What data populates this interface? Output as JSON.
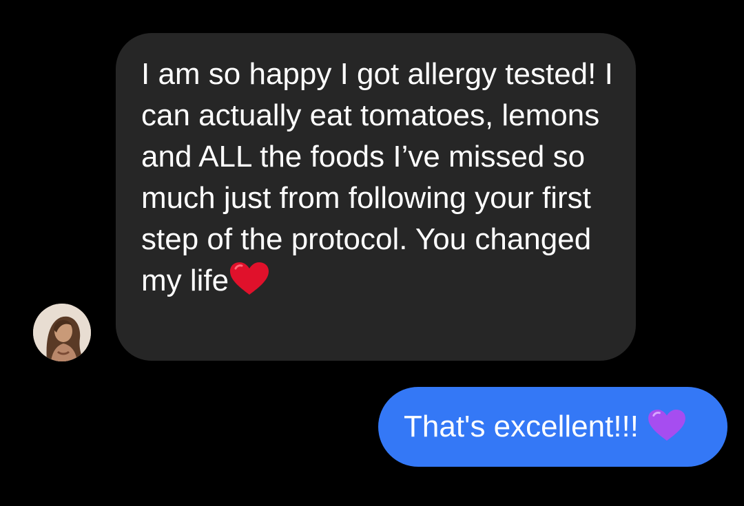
{
  "conversation": {
    "incoming": {
      "sender_avatar": "profile-photo",
      "text": "I am so happy I got allergy tested! I can actually eat tomatoes, lemons and ALL the foods I’ve missed so much just from following your first step of the protocol. You changed my life",
      "emoji": "red-heart",
      "bubble_color": "#262626"
    },
    "outgoing": {
      "text": "That's excellent!!!",
      "emoji": "purple-heart",
      "bubble_color": "#3478f6"
    }
  },
  "colors": {
    "background": "#000000",
    "text": "#ffffff",
    "red_heart": "#e0112b",
    "purple_heart": "#a64df0"
  }
}
